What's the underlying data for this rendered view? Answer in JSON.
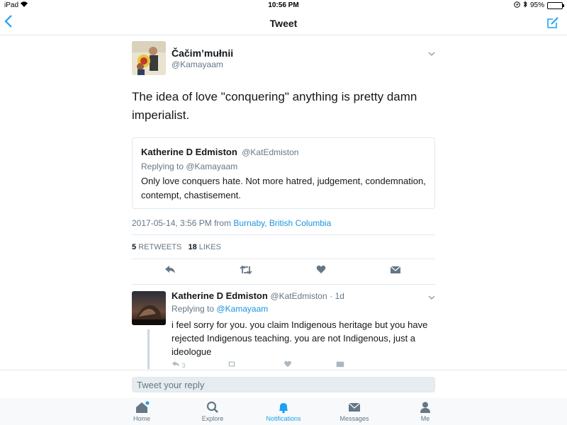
{
  "status_bar": {
    "device": "iPad",
    "time": "10:56 PM",
    "battery": "95%"
  },
  "nav": {
    "title": "Tweet"
  },
  "tweet": {
    "author_name": "Čačim’mułnii",
    "author_handle": "@Kamayaam",
    "text": "The idea of love \"conquering\" anything is pretty damn imperialist.",
    "quoted": {
      "author_name": "Katherine D Edmiston",
      "author_handle": "@KatEdmiston",
      "replying_to": "Replying to @Kamayaam",
      "text": "Only love conquers hate. Not more hatred, judgement, condemnation, contempt, chastisement."
    },
    "timestamp": "2017-05-14, 3:56 PM from",
    "location": "Burnaby, British Columbia",
    "retweets_count": "5",
    "retweets_label": "RETWEETS",
    "likes_count": "18",
    "likes_label": "LIKES"
  },
  "reply": {
    "author_name": "Katherine D Edmiston",
    "author_handle": "@KatEdmiston",
    "age": "· 1d",
    "replying_prefix": "Replying to",
    "replying_handle": "@Kamayaam",
    "text": "i feel sorry for you. you claim Indigenous heritage but you have rejected Indigenous teaching. you are not Indigenous, just a ideologue",
    "reply_count": "3"
  },
  "compose": {
    "placeholder": "Tweet your reply"
  },
  "tabs": [
    {
      "label": "Home",
      "icon": "home-icon"
    },
    {
      "label": "Explore",
      "icon": "search-icon"
    },
    {
      "label": "Notifications",
      "icon": "bell-icon"
    },
    {
      "label": "Messages",
      "icon": "envelope-icon"
    },
    {
      "label": "Me",
      "icon": "person-icon"
    }
  ],
  "colors": {
    "accent": "#1da1f2",
    "link": "#1b95e0",
    "muted": "#657786",
    "border": "#e1e8ed"
  }
}
